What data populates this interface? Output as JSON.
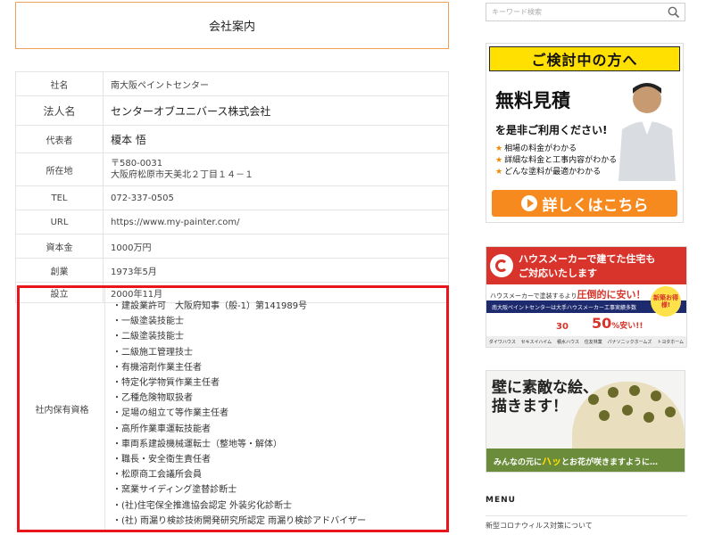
{
  "main": {
    "title": "会社案内",
    "rows": [
      {
        "label": "社名",
        "value": "南大阪ペイントセンター"
      },
      {
        "label": "法人名",
        "value": "センターオブユニバース株式会社"
      },
      {
        "label": "代表者",
        "value": "榎本 悟"
      },
      {
        "label": "所在地",
        "value": "〒580-0031",
        "value2": "大阪府松原市天美北２丁目１４－１"
      },
      {
        "label": "TEL",
        "value": "072-337-0505"
      },
      {
        "label": "URL",
        "value": "https://www.my-painter.com/"
      },
      {
        "label": "資本金",
        "value": "1000万円"
      },
      {
        "label": "創業",
        "value": "1973年5月"
      },
      {
        "label": "設立",
        "value": "2000年11月"
      }
    ],
    "qualifications": {
      "label": "社内保有資格",
      "items": [
        "建設業許可　大阪府知事（般-1）第141989号",
        "一級塗装技能士",
        "二級塗装技能士",
        "二級施工管理技士",
        "有機溶剤作業主任者",
        "特定化学物質作業主任者",
        "乙種危険物取扱者",
        "足場の組立て等作業主任者",
        "高所作業車運転技能者",
        "車両系建設機械運転士（整地等・解体）",
        "職長・安全衛生責任者",
        "松原商工会議所会員",
        "窯業サイディング塗替診断士",
        "(社)住宅保全推進協会認定 外装劣化診断士",
        "(社) 雨漏り検診技術開発研究所認定 雨漏り検診アドバイザー"
      ]
    }
  },
  "sidebar": {
    "search": {
      "placeholder": "キーワード検索",
      "icon": "search-icon"
    },
    "banner1": {
      "heading": "ご検討中の方へ",
      "big": "無料見積",
      "sub": "を是非ご利用ください!",
      "bullets": [
        "相場の料金がわかる",
        "詳細な料金と工事内容がわかる",
        "どんな塗料が最適かわかる"
      ],
      "button": "詳しくはこちら",
      "accent": "#f68a1f",
      "head_color": "#ffe000"
    },
    "banner2": {
      "line1": "ハウスメーカーで建てた住宅も",
      "line2": "ご対応いたします",
      "mid_prefix": "ハウスメーカーで塗装するより",
      "mid_bold": "圧倒的に安い！",
      "band": "南大阪ペイントセンターは大手ハウスメーカー工事実績多数",
      "badge": "新築お得様!",
      "percent": "50",
      "percent_suffix": "%安い!!",
      "thirty": "30",
      "logos": [
        "ダイワハウス",
        "セキスイハイム",
        "積水ハウス",
        "住友林業",
        "パナソニックホームズ",
        "トヨタホーム"
      ],
      "color": "#d8342b"
    },
    "banner3": {
      "title1": "壁に素敵な絵、",
      "title2": "描きます！",
      "caption_a": "みんなの元に",
      "caption_b": "ハッ",
      "caption_c": "とお花が咲きますように…"
    },
    "menu": {
      "title": "MENU",
      "items": [
        "新型コロナウィルス対策について"
      ]
    }
  }
}
